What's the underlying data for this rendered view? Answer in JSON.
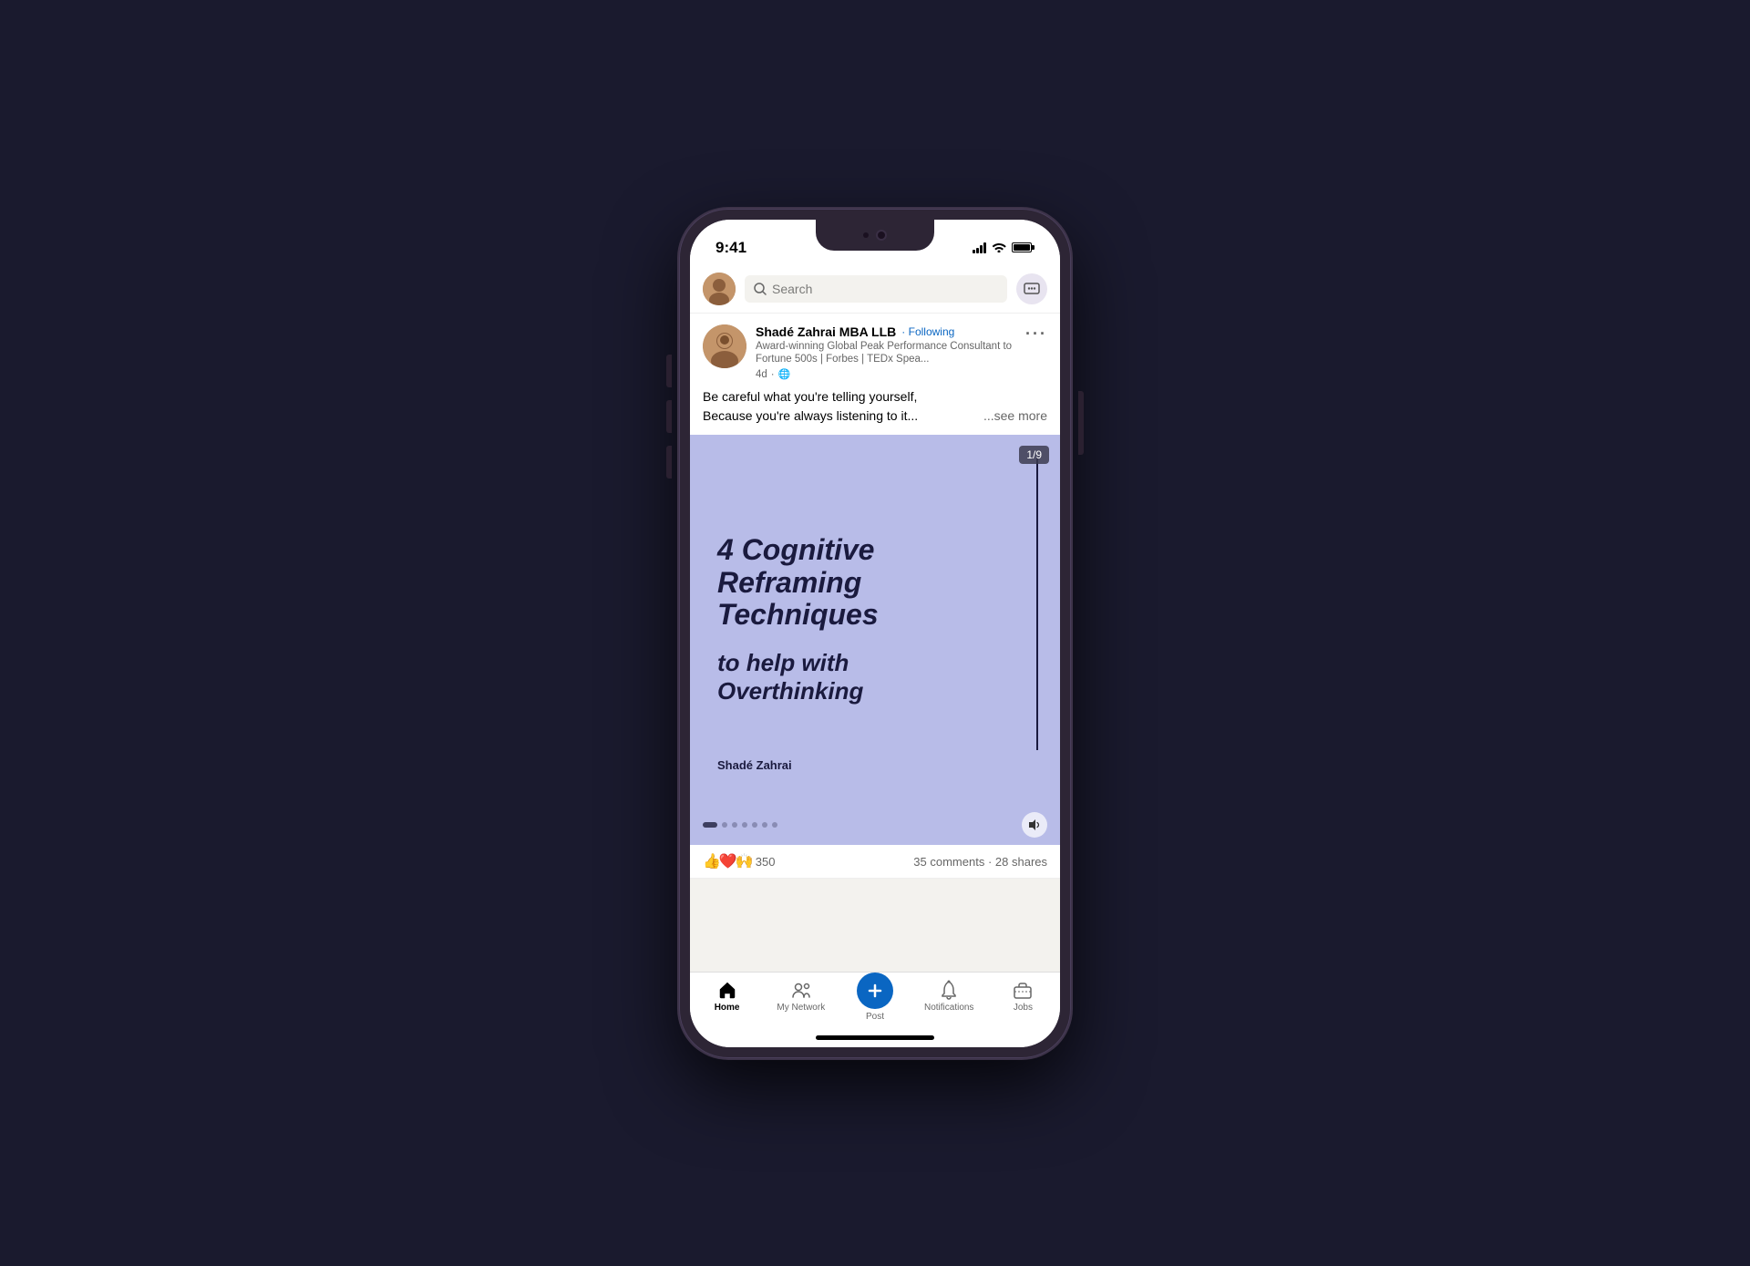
{
  "phone": {
    "status_bar": {
      "time": "9:41",
      "signal_bars": 4,
      "wifi": true,
      "battery_full": true
    }
  },
  "app": {
    "top_bar": {
      "search_placeholder": "Search",
      "messaging_icon": "💬"
    },
    "post": {
      "author": "Shadé Zahrai MBA LLB",
      "following_label": "· Following",
      "subtitle": "Award-winning Global Peak Performance Consultant to Fortune 500s | Forbes | TEDx Spea...",
      "time": "4d",
      "more_icon": "···",
      "body_text": "Be careful what you're telling yourself,\nBecause you're always listening to it...",
      "see_more": "...see more",
      "slide_counter": "1/9",
      "card_title_line1": "4 Cognitive",
      "card_title_line2": "Reframing",
      "card_title_line3": "Techniques",
      "card_subtitle_line1": "to help with",
      "card_subtitle_line2": "Overthinking",
      "card_author": "Shadé Zahrai",
      "reactions_count": "350",
      "comments": "35 comments",
      "shares": "28 shares"
    },
    "bottom_nav": {
      "items": [
        {
          "icon": "🏠",
          "label": "Home",
          "active": true
        },
        {
          "icon": "👥",
          "label": "My Network",
          "active": false
        },
        {
          "icon": "➕",
          "label": "Post",
          "active": false
        },
        {
          "icon": "🔔",
          "label": "Notifications",
          "active": false
        },
        {
          "icon": "💼",
          "label": "Jobs",
          "active": false
        }
      ]
    }
  }
}
